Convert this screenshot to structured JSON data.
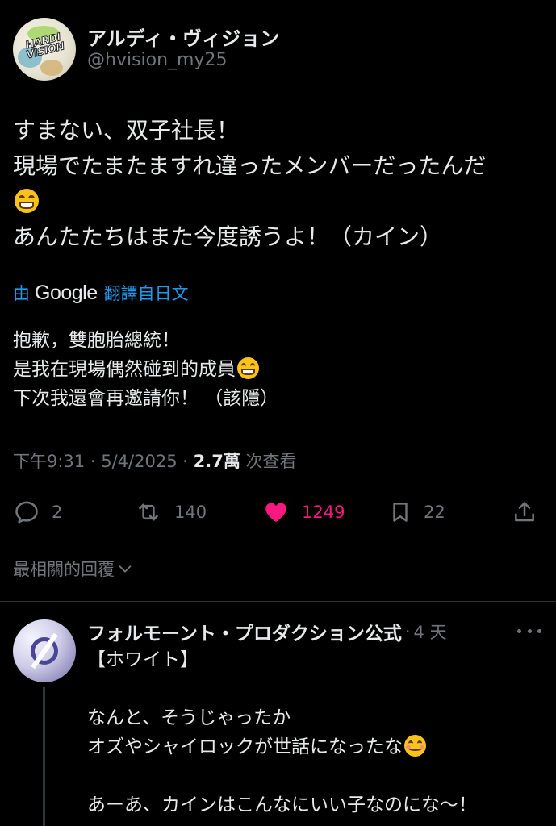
{
  "post": {
    "display_name": "アルディ・ヴィジョン",
    "handle": "@hvision_my25",
    "avatar_text": "HARDI VISION",
    "text_lines": [
      "すまない、双子社長！",
      "現場でたまたますれ違ったメンバーだったんだ",
      "",
      "あんたたちはまた今度誘うよ！（カイン）"
    ],
    "translation": {
      "by": "由",
      "provider": "Google",
      "from": "翻譯自日文",
      "lines": [
        "抱歉，雙胞胎總統！",
        "是我在現場偶然碰到的成員",
        "下次我還會再邀請你！ （該隱）"
      ]
    },
    "time": "下午9:31",
    "dot1": "·",
    "date": "5/4/2025",
    "dot2": "·",
    "views_count": "2.7萬",
    "views_label": "次查看",
    "actions": {
      "replies": "2",
      "reposts": "140",
      "likes": "1249",
      "bookmarks": "22"
    },
    "like_color": "#f91880"
  },
  "replies_filter": "最相關的回覆",
  "reply": {
    "name": "フォルモーント・プロダクション公式",
    "sep": "·",
    "time": "4 天",
    "lines": [
      "【ホワイト】",
      "",
      "なんと、そうじゃったか",
      "オズやシャイロックが世話になったな",
      "",
      "あーあ、カインはこんなにいい子なのにな～！"
    ]
  }
}
